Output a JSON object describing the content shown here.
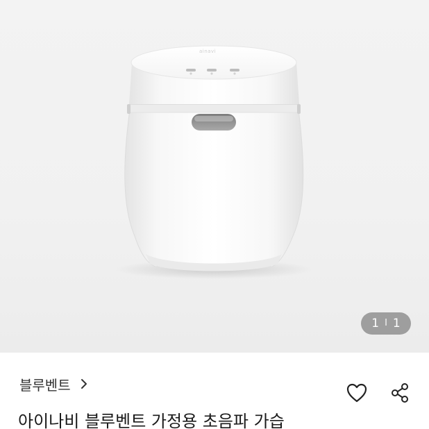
{
  "gallery": {
    "current": "1",
    "separator": "I",
    "total": "1"
  },
  "store": {
    "name": "블루벤트",
    "chevron_icon": "chevron-right-icon"
  },
  "actions": {
    "like_icon": "heart-icon",
    "share_icon": "share-icon"
  },
  "product": {
    "title": "아이나비 블루벤트 가정용 초음파 가습",
    "device_label": "ainavi"
  },
  "colors": {
    "background": "#f1f1f1",
    "text_primary": "#1a1a1a",
    "pager_bg": "#6e6e6e"
  }
}
